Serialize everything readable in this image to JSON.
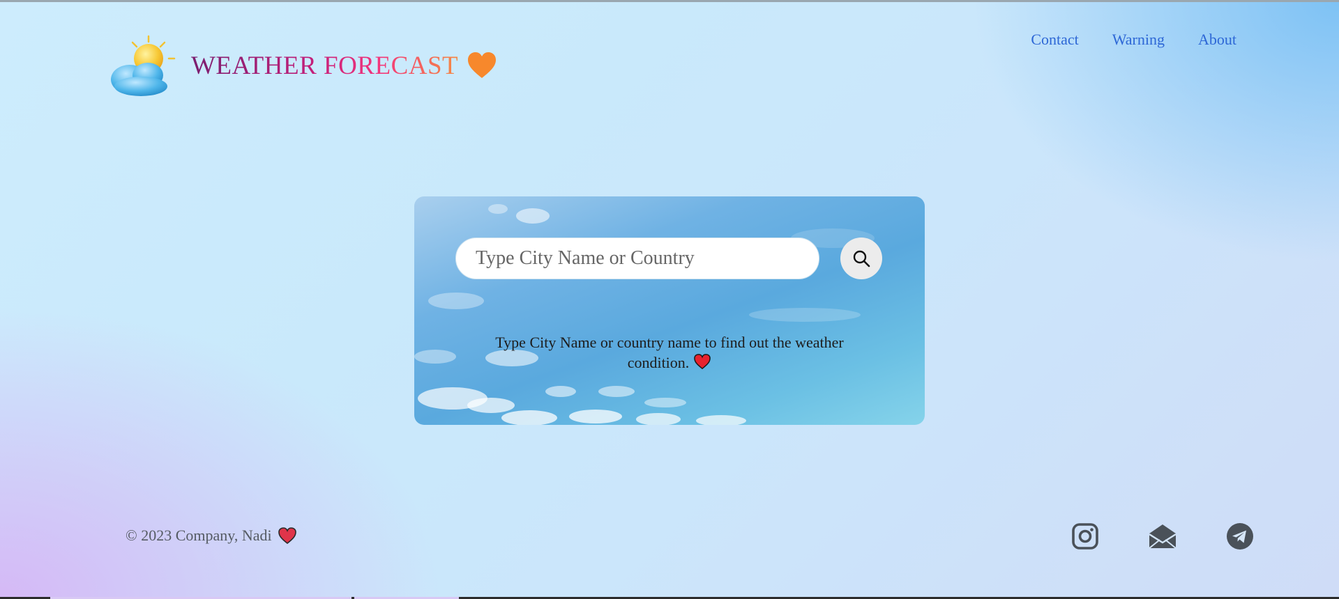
{
  "header": {
    "brand_title": "WEATHER FORECAST",
    "logo_icon": "sun-behind-cloud-icon",
    "title_heart_icon": "orange-heart-icon",
    "nav": [
      {
        "label": "Contact"
      },
      {
        "label": "Warning"
      },
      {
        "label": "About"
      }
    ]
  },
  "search": {
    "placeholder": "Type City Name or Country",
    "value": "",
    "button_icon": "search-icon",
    "hint": "Type City Name or country name to find out the weather condition.",
    "hint_icon": "red-heart-icon"
  },
  "footer": {
    "copyright": "© 2023 Company, Nadi",
    "heart_icon": "red-heart-icon",
    "social": [
      {
        "icon": "instagram-icon"
      },
      {
        "icon": "envelope-open-icon"
      },
      {
        "icon": "telegram-icon"
      }
    ]
  },
  "colors": {
    "nav_link": "#2d67d6",
    "title_gradient": [
      "#7a1e6f",
      "#c21f7a",
      "#f2357d",
      "#f58a45"
    ],
    "footer_text": "#555b63",
    "social_icon": "#4a5159"
  }
}
